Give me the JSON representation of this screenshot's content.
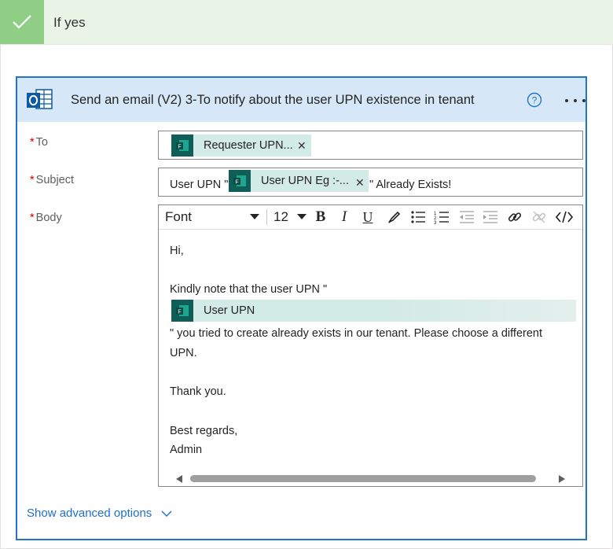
{
  "condition": {
    "label": "If yes"
  },
  "action": {
    "title": "Send an email (V2) 3-To notify about the user UPN existence in tenant",
    "icon": "outlook-icon"
  },
  "fields": {
    "to": {
      "label": "To",
      "required": "*",
      "token": "Requester UPN..."
    },
    "subject": {
      "label": "Subject",
      "required": "*",
      "prefix": "User UPN \"",
      "token": "User UPN Eg :-...",
      "suffix": "\" Already Exists!"
    },
    "body": {
      "label": "Body",
      "required": "*",
      "toolbar": {
        "font": "Font",
        "size": "12"
      },
      "lines": {
        "greeting": "Hi,",
        "note": "Kindly note that the user UPN \"",
        "token": "User UPN",
        "line3": "\" you tried to create already exists in our tenant. Please choose a different",
        "line4": "UPN.",
        "thanks": "Thank you.",
        "regards": "Best regards,",
        "signature": "Admin"
      }
    }
  },
  "advanced": {
    "label": "Show advanced options"
  },
  "colors": {
    "accent": "#1f76c5",
    "success": "#8fce84",
    "token_bg": "#d3ebe6",
    "token_icon": "#0f5e58",
    "link": "#1f6fd0"
  }
}
